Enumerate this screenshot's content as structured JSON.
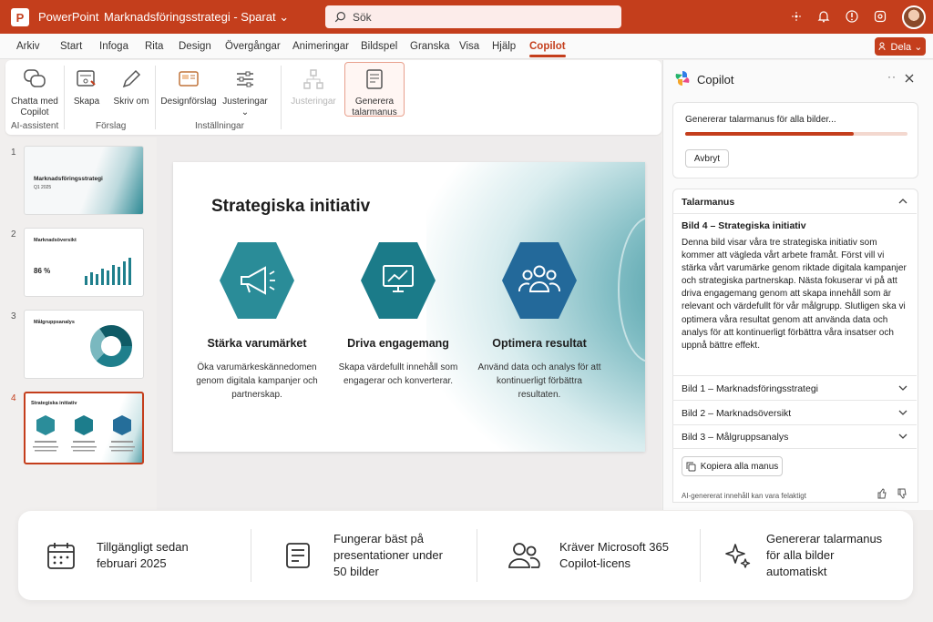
{
  "titlebar": {
    "app": "PowerPoint",
    "document": "Marknadsföringsstrategi - Sparat ⌄",
    "search_placeholder": "Sök",
    "logo": "P"
  },
  "tabs": [
    "Arkiv",
    "Start",
    "Infoga",
    "Rita",
    "Design",
    "Övergångar",
    "Animeringar",
    "Bildspel",
    "Granska",
    "Visa",
    "Hjälp",
    "Copilot"
  ],
  "share_label": "Dela ⌄",
  "ribbon": {
    "chat": "Chatta med Copilot",
    "group_ai": "AI-assistent",
    "create": "Skapa",
    "rewrite": "Skriv om",
    "group_suggestions": "Förslag",
    "design_ideas": "Designförslag",
    "adjustments": "Justeringar ⌄",
    "group_settings": "Inställningar",
    "adjustments_disabled": "Justeringar",
    "generate": "Generera talarmanus"
  },
  "thumbnails": [
    {
      "num": "1",
      "title": "Marknadsföringsstrategi",
      "subtitle": "Q1 2025"
    },
    {
      "num": "2",
      "title": "Marknadsöversikt",
      "value": "86 %"
    },
    {
      "num": "3",
      "title": "Målgruppsanalys"
    },
    {
      "num": "4",
      "title": "Strategiska initiativ"
    }
  ],
  "slide": {
    "title": "Strategiska initiativ",
    "columns": [
      {
        "title": "Stärka varumärket",
        "desc": "Öka varumärkeskännedomen genom digitala kampanjer och partnerskap.",
        "icon": "megaphone-icon"
      },
      {
        "title": "Driva engagemang",
        "desc": "Skapa värdefullt innehåll som engagerar och konverterar.",
        "icon": "monitor-chart-icon"
      },
      {
        "title": "Optimera resultat",
        "desc": "Använd data och analys för att kontinuerligt förbättra resultaten.",
        "icon": "people-icon"
      }
    ]
  },
  "copilot": {
    "title": "Copilot",
    "status": "Genererar talarmanus för alla bilder...",
    "progress": 0.76,
    "cancel": "Avbryt",
    "notes_title": "Talarmanus",
    "current_title": "Bild 4 – Strategiska initiativ",
    "current_text": "Denna bild visar våra tre strategiska initiativ som kommer att vägleda vårt arbete framåt. Först vill vi stärka vårt varumärke genom riktade digitala kampanjer och strategiska partnerskap. Nästa fokuserar vi på att driva engagemang genom att skapa innehåll som är relevant och värdefullt för vår målgrupp. Slutligen ska vi optimera våra resultat genom att använda data och analys för att kontinuerligt förbättra våra insatser och uppnå bättre effekt.",
    "others": [
      "Bild 1 – Marknadsföringsstrategi",
      "Bild 2 – Marknadsöversikt",
      "Bild 3 – Målgruppsanalys"
    ],
    "copy_all": "Kopiera alla manus",
    "disclaimer": "AI-genererat innehåll kan vara felaktigt"
  },
  "footer": [
    {
      "text1": "Tillgängligt sedan",
      "text2": "februari 2025",
      "text3": "",
      "icon": "calendar-icon"
    },
    {
      "text1": "Fungerar bäst på",
      "text2": "presentationer under",
      "text3": "50 bilder",
      "icon": "document-icon"
    },
    {
      "text1": "Kräver Microsoft 365",
      "text2": "Copilot-licens",
      "text3": "",
      "icon": "people-icon"
    },
    {
      "text1": "Genererar talarmanus",
      "text2": "för alla bilder",
      "text3": "automatiskt",
      "icon": "sparkle-icon"
    }
  ],
  "colors": {
    "accent": "#c43e1c",
    "teal": "#1f7f8c"
  }
}
